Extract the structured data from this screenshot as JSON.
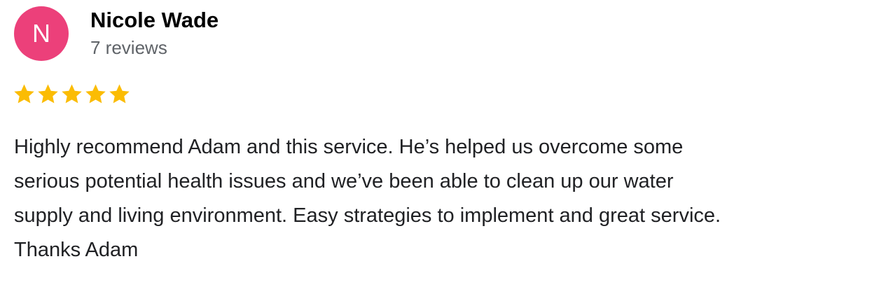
{
  "review": {
    "avatar_letter": "N",
    "avatar_color": "#ec407a",
    "author_name": "Nicole Wade",
    "review_count": "7 reviews",
    "rating": 5,
    "rating_max": 5,
    "star_color": "#fbbc04",
    "text_lines": [
      "Highly recommend Adam and this service. He’s helped us overcome some",
      "serious potential health issues and we’ve been able to clean up our water",
      "supply and living environment. Easy strategies to implement and great service.",
      "Thanks Adam"
    ]
  }
}
